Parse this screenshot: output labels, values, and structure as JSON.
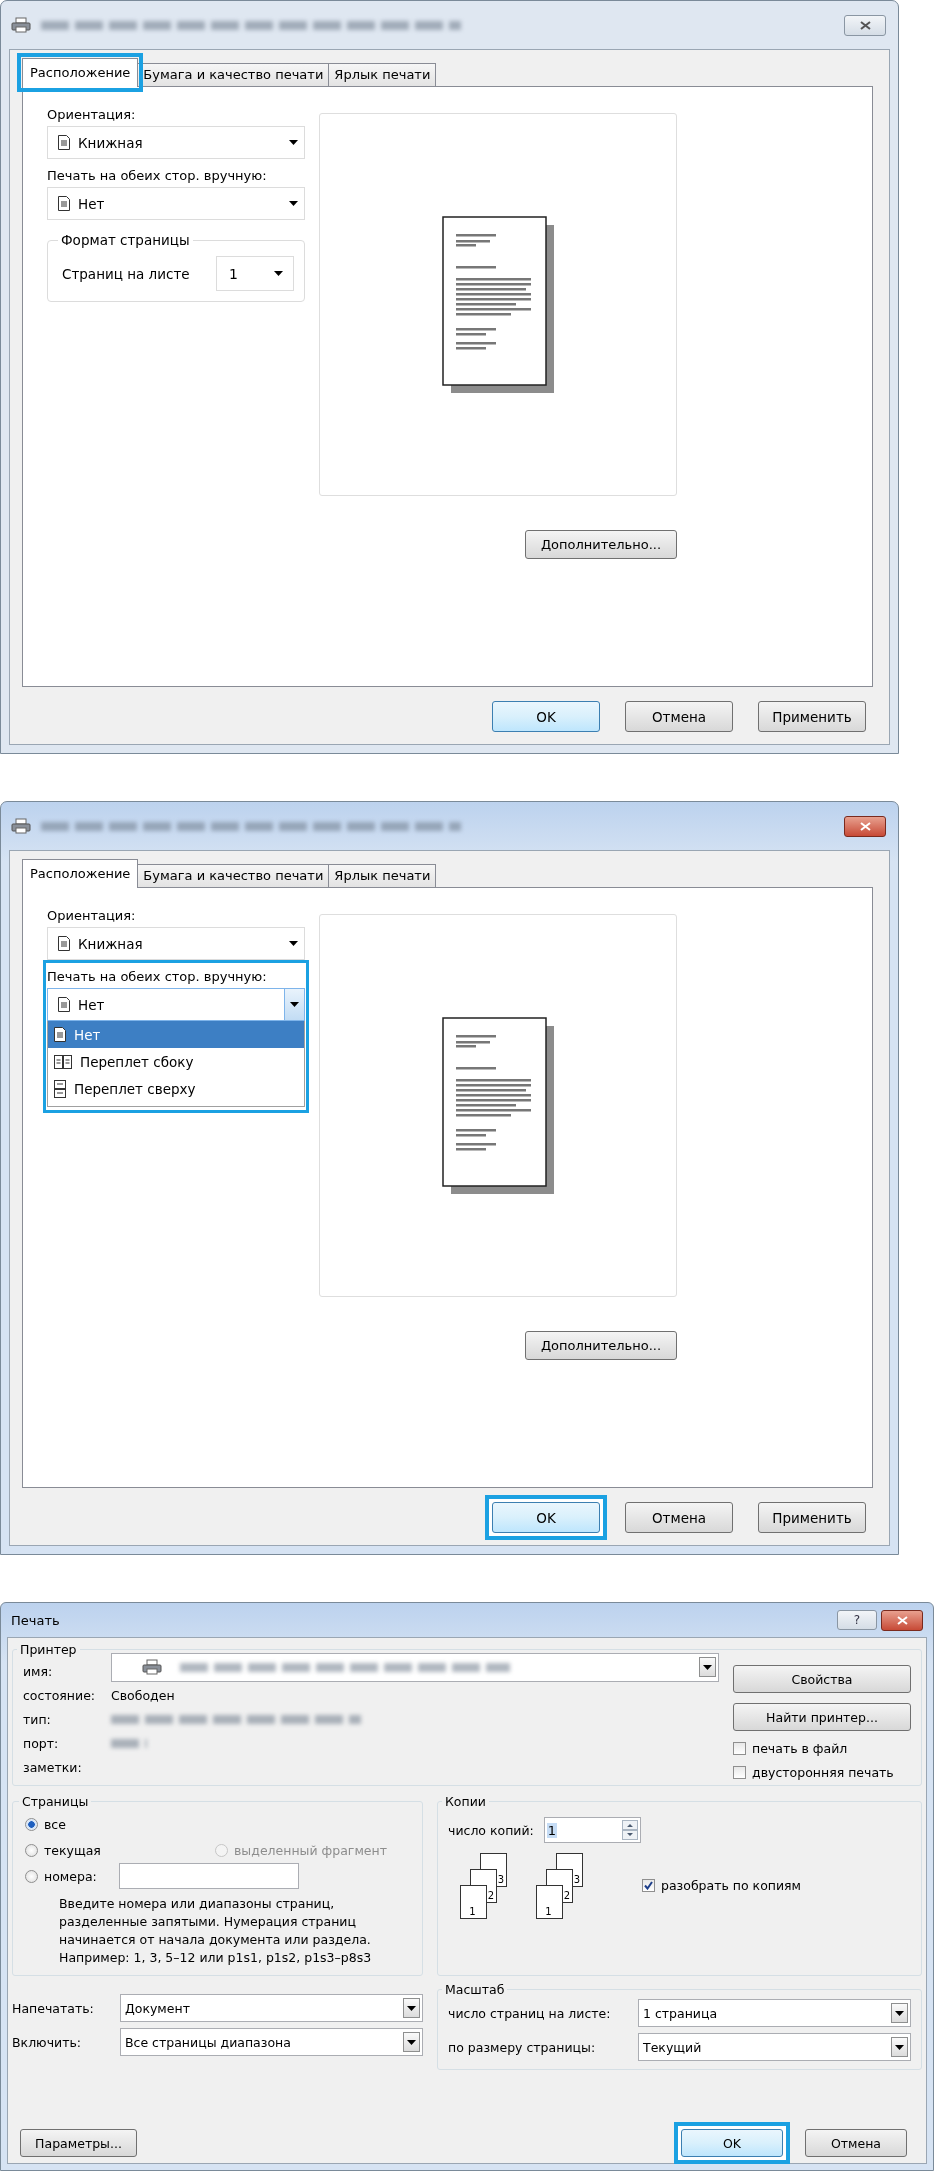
{
  "dialogs": [
    {
      "kind": "properties",
      "active": false,
      "tabs": [
        {
          "label": "Расположение",
          "selected": true,
          "highlighted": true
        },
        {
          "label": "Бумага и качество печати",
          "selected": false,
          "highlighted": false
        },
        {
          "label": "Ярлык печати",
          "selected": false,
          "highlighted": false
        }
      ],
      "orientation": {
        "label": "Ориентация:",
        "value": "Книжная"
      },
      "duplex": {
        "label": "Печать на обеих стор. вручную:",
        "value": "Нет",
        "expanded": false,
        "highlighted": false
      },
      "page_format": {
        "title": "Формат страницы",
        "label": "Страниц на листе",
        "value": "1"
      },
      "advanced_button": "Дополнительно...",
      "buttons": [
        {
          "label": "OK",
          "default": true,
          "highlighted": false
        },
        {
          "label": "Отмена",
          "default": false,
          "highlighted": false
        },
        {
          "label": "Применить",
          "default": false,
          "highlighted": false
        }
      ]
    },
    {
      "kind": "properties",
      "active": true,
      "tabs": [
        {
          "label": "Расположение",
          "selected": true,
          "highlighted": false
        },
        {
          "label": "Бумага и качество печати",
          "selected": false,
          "highlighted": false
        },
        {
          "label": "Ярлык печати",
          "selected": false,
          "highlighted": false
        }
      ],
      "orientation": {
        "label": "Ориентация:",
        "value": "Книжная"
      },
      "duplex": {
        "label": "Печать на обеих стор. вручную:",
        "value": "Нет",
        "expanded": true,
        "highlighted": true,
        "options": [
          {
            "label": "Нет",
            "kind": "single",
            "selected": true
          },
          {
            "label": "Переплет сбоку",
            "kind": "side",
            "selected": false
          },
          {
            "label": "Переплет сверху",
            "kind": "top",
            "selected": false
          }
        ]
      },
      "advanced_button": "Дополнительно...",
      "buttons": [
        {
          "label": "OK",
          "default": true,
          "highlighted": true
        },
        {
          "label": "Отмена",
          "default": false,
          "highlighted": false
        },
        {
          "label": "Применить",
          "default": false,
          "highlighted": false
        }
      ]
    },
    {
      "kind": "print",
      "active": true,
      "title": "Печать",
      "help_button": "?",
      "printer": {
        "title": "Принтер",
        "name_label": "имя:",
        "status_label": "состояние:",
        "status": "Свободен",
        "type_label": "тип:",
        "port_label": "порт:",
        "comment_label": "заметки:",
        "properties_button": "Свойства",
        "find_button": "Найти принтер...",
        "checkboxes": [
          {
            "label": "печать в файл",
            "checked": false
          },
          {
            "label": "двусторонняя печать",
            "checked": false
          }
        ]
      },
      "pages": {
        "title": "Страницы",
        "options": [
          {
            "label": "все",
            "selected": true,
            "disabled": false
          },
          {
            "label": "текущая",
            "selected": false,
            "disabled": false
          },
          {
            "label": "выделенный фрагмент",
            "selected": false,
            "disabled": true
          },
          {
            "label": "номера:",
            "selected": false,
            "disabled": false
          }
        ],
        "hint": "Введите номера или диапазоны страниц,\nразделенные запятыми. Нумерация страниц\nначинается от начала документа или раздела.\nНапример: 1, 3, 5–12 или p1s1, p1s2, p1s3–p8s3"
      },
      "copies": {
        "title": "Копии",
        "count_label": "число копий:",
        "count": "1",
        "stacks": [
          [
            "1",
            "2",
            "3"
          ],
          [
            "1",
            "2",
            "3"
          ]
        ],
        "collate": {
          "label": "разобрать по копиям",
          "checked": true
        }
      },
      "print_what": {
        "label": "Напечатать:",
        "value": "Документ"
      },
      "include": {
        "label": "Включить:",
        "value": "Все страницы диапазона"
      },
      "zoom": {
        "title": "Масштаб",
        "pages_per_sheet_label": "число страниц на листе:",
        "pages_per_sheet": "1 страница",
        "scale_label": "по размеру страницы:",
        "scale": "Текущий"
      },
      "options_button": "Параметры...",
      "buttons": [
        {
          "label": "OK",
          "default": true,
          "highlighted": true
        },
        {
          "label": "Отмена",
          "default": false,
          "highlighted": false
        }
      ]
    }
  ]
}
